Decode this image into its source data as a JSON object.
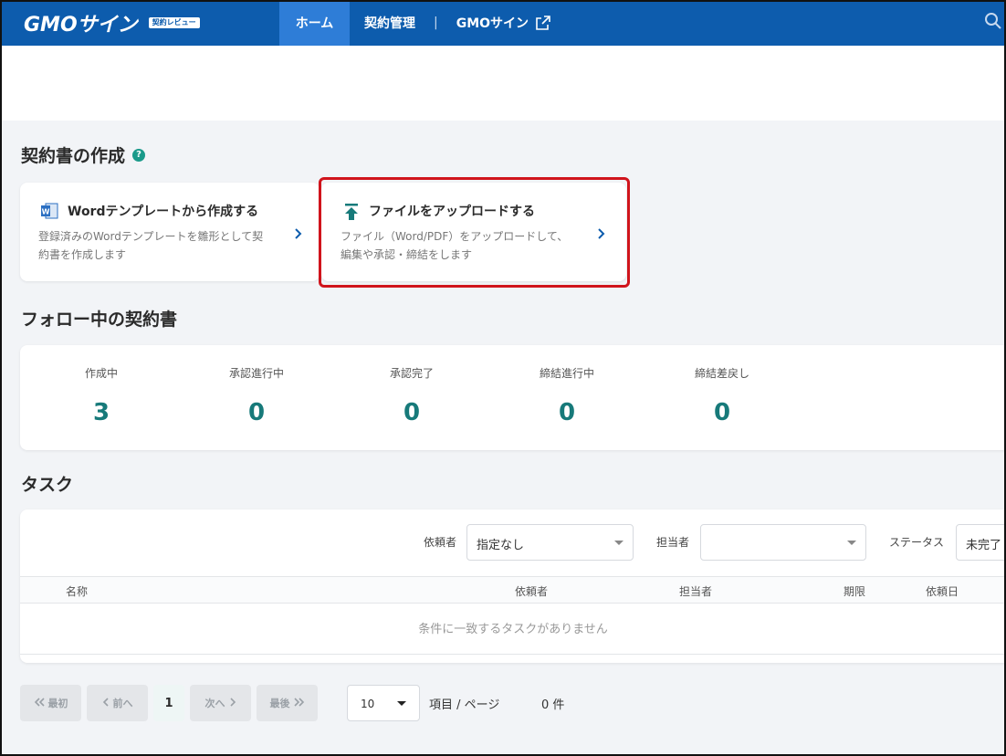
{
  "header": {
    "logo": "GMOサイン",
    "logo_badge": "契約レビュー",
    "tabs": [
      {
        "label": "ホーム",
        "active": true
      },
      {
        "label": "契約管理",
        "active": false
      },
      {
        "label": "GMOサイン",
        "active": false
      }
    ],
    "separator": "|"
  },
  "create_section": {
    "title": "契約書の作成",
    "help": "?",
    "cards": [
      {
        "title": "Wordテンプレートから作成する",
        "desc_line1": "登録済みのWordテンプレートを雛形として契",
        "desc_line2": "約書を作成します",
        "icon": "word-icon"
      },
      {
        "title": "ファイルをアップロードする",
        "desc_line1": "ファイル（Word/PDF）をアップロードして、",
        "desc_line2": "編集や承認・締結をします",
        "icon": "upload-icon"
      }
    ]
  },
  "follow_section": {
    "title": "フォロー中の契約書",
    "stats": [
      {
        "label": "作成中",
        "value": "3"
      },
      {
        "label": "承認進行中",
        "value": "0"
      },
      {
        "label": "承認完了",
        "value": "0"
      },
      {
        "label": "締結進行中",
        "value": "0"
      },
      {
        "label": "締結差戻し",
        "value": "0"
      }
    ]
  },
  "task_section": {
    "title": "タスク",
    "filters": {
      "requester_label": "依頼者",
      "requester_value": "指定なし",
      "assignee_label": "担当者",
      "assignee_value": "",
      "status_label": "ステータス",
      "status_value": "未完了"
    },
    "columns": [
      "名称",
      "依頼者",
      "担当者",
      "期限",
      "依頼日"
    ],
    "empty_message": "条件に一致するタスクがありません"
  },
  "pagination": {
    "first": "最初",
    "prev": "前へ",
    "current": "1",
    "next": "次へ",
    "last": "最後",
    "page_size": "10",
    "per_page_label": "項目 / ページ",
    "count_label": "0 件"
  },
  "colors": {
    "header_bg": "#0d5cad",
    "active_tab": "#2e7dd7",
    "accent_teal": "#177a7a",
    "highlight_red": "#d0141c"
  }
}
